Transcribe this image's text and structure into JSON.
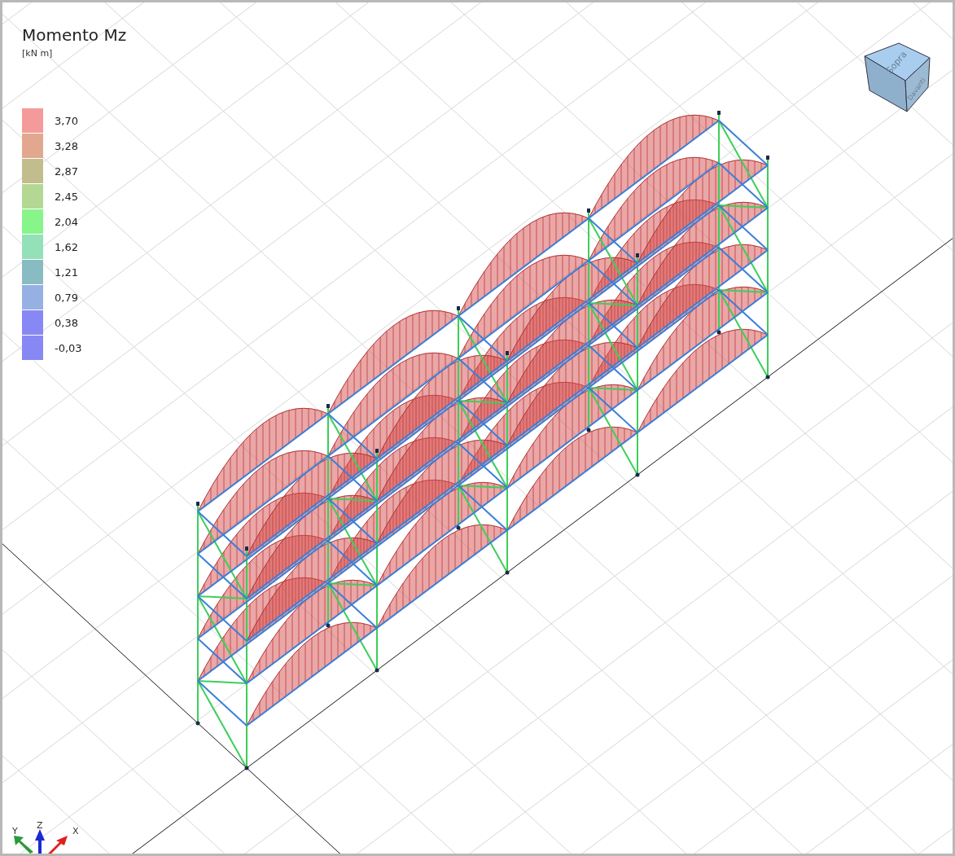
{
  "title": "Momento Mz",
  "unit": "[kN m]",
  "legend": [
    {
      "label": "3,70",
      "color": "#f59a9a"
    },
    {
      "label": "3,28",
      "color": "#e2a88f"
    },
    {
      "label": "2,87",
      "color": "#c2bd8c"
    },
    {
      "label": "2,45",
      "color": "#b4d893"
    },
    {
      "label": "2,04",
      "color": "#88f58a"
    },
    {
      "label": "1,62",
      "color": "#94e0b8"
    },
    {
      "label": "1,21",
      "color": "#88bcc2"
    },
    {
      "label": "0,79",
      "color": "#96b0e4"
    },
    {
      "label": "0,38",
      "color": "#8888f4"
    },
    {
      "label": "-0,03",
      "color": "#8888f4"
    }
  ],
  "view_cube": {
    "top": "Sopra",
    "front": "Davanti"
  },
  "axes": {
    "x": "X",
    "y": "Y",
    "z": "Z"
  }
}
